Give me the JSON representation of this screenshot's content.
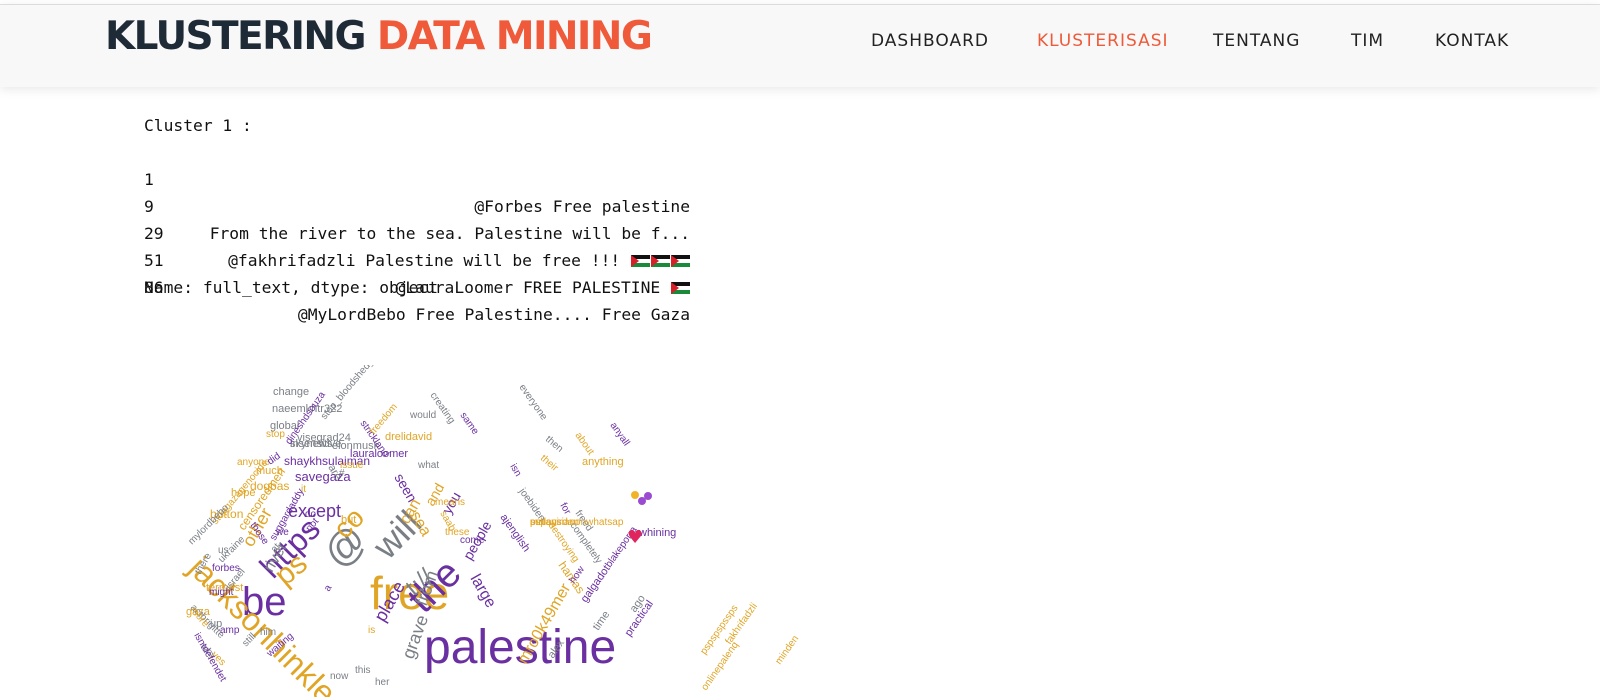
{
  "header": {
    "brand_part1": "KLUSTERING",
    "brand_part2": "DATA MINING",
    "nav": [
      {
        "label": "DASHBOARD",
        "active": false
      },
      {
        "label": "KLUSTERISASI",
        "active": true
      },
      {
        "label": "TENTANG",
        "active": false
      },
      {
        "label": "TIM",
        "active": false
      },
      {
        "label": "KONTAK",
        "active": false
      }
    ]
  },
  "output": {
    "heading": "Cluster 1 :",
    "rows": [
      {
        "index": "1",
        "text": "@Forbes Free palestine",
        "flags": 0
      },
      {
        "index": "9",
        "text": "From the river to the sea. Palestine will be f...",
        "flags": 0
      },
      {
        "index": "29",
        "text": "@fakhrifadzli Palestine will be free !!! ",
        "flags": 3
      },
      {
        "index": "51",
        "text": "@LauraLoomer FREE PALESTINE ",
        "flags": 1
      },
      {
        "index": "86",
        "text": "@MyLordBebo Free Palestine.... Free Gaza",
        "flags": 0
      }
    ],
    "footer": "Name: full_text, dtype: object"
  },
  "colors": {
    "brand_dark": "#1f2a37",
    "accent": "#ee5a3a",
    "wordcloud_purple": "#6a2fa0",
    "wordcloud_gold": "#e0a526",
    "wordcloud_gray": "#7a7f86"
  },
  "wordcloud": {
    "words": [
      {
        "text": "palestine",
        "color": "#6a2fa0"
      },
      {
        "text": "free",
        "color": "#e0a526"
      },
      {
        "text": "be",
        "color": "#6a2fa0"
      },
      {
        "text": "the",
        "color": "#6a2fa0"
      },
      {
        "text": "@",
        "color": "#7a7f86"
      },
      {
        "text": "will",
        "color": "#7a7f86"
      },
      {
        "text": "jacksonhinkle",
        "color": "#e0a526"
      },
      {
        "text": "https",
        "color": "#6a2fa0"
      },
      {
        "text": "co",
        "color": "#e0a526"
      },
      {
        "text": "ps",
        "color": "#e0a526"
      },
      {
        "text": "t://",
        "color": "#7a7f86"
      },
      {
        "text": "except",
        "color": "#6a2fa0"
      },
      {
        "text": "from",
        "color": "#7a7f86"
      },
      {
        "text": "place",
        "color": "#6a2fa0"
      },
      {
        "text": "grave",
        "color": "#7a7f86"
      },
      {
        "text": "large",
        "color": "#6a2fa0"
      },
      {
        "text": "people",
        "color": "#6a2fa0"
      },
      {
        "text": "mro0k49mer",
        "color": "#e0a526"
      },
      {
        "text": "other",
        "color": "#e0a526"
      },
      {
        "text": "river",
        "color": "#7a7f86"
      },
      {
        "text": "sea",
        "color": "#e0a526"
      },
      {
        "text": "you",
        "color": "#6a2fa0"
      },
      {
        "text": "can",
        "color": "#e0a526"
      },
      {
        "text": "and",
        "color": "#e0a526"
      },
      {
        "text": "seen",
        "color": "#6a2fa0"
      },
      {
        "text": "savegaza",
        "color": "#6a2fa0"
      },
      {
        "text": "shaykhsulaiman",
        "color": "#6a2fa0"
      },
      {
        "text": "censoredmen",
        "color": "#e0a526"
      },
      {
        "text": "dogbas",
        "color": "#e0a526"
      },
      {
        "text": "button",
        "color": "#e0a526"
      },
      {
        "text": "hope",
        "color": "#e0a526"
      },
      {
        "text": "much",
        "color": "#e0a526"
      },
      {
        "text": "anything",
        "color": "#e0a526"
      },
      {
        "text": "anyone",
        "color": "#e0a526"
      },
      {
        "text": "whining",
        "color": "#6a2fa0"
      },
      {
        "text": "change",
        "color": "#7a7f86"
      },
      {
        "text": "naeemkhtr322",
        "color": "#7a7f86"
      },
      {
        "text": "visegrad24",
        "color": "#7a7f86"
      },
      {
        "text": "elonmusk",
        "color": "#7a7f86"
      },
      {
        "text": "lauraloomer",
        "color": "#6a2fa0"
      },
      {
        "text": "skynews",
        "color": "#7a7f86"
      },
      {
        "text": "drelidavid",
        "color": "#e0a526"
      },
      {
        "text": "terrorist",
        "color": "#e0a526"
      },
      {
        "text": "gaza",
        "color": "#e0a526"
      },
      {
        "text": "hamas",
        "color": "#e0a526"
      },
      {
        "text": "alex",
        "color": "#7a7f86"
      },
      {
        "text": "time",
        "color": "#7a7f86"
      },
      {
        "text": "ago",
        "color": "#7a7f86"
      },
      {
        "text": "practical",
        "color": "#6a2fa0"
      },
      {
        "text": "blakeporra",
        "color": "#6a2fa0"
      },
      {
        "text": "galgadot",
        "color": "#6a2fa0"
      },
      {
        "text": "how",
        "color": "#6a2fa0"
      },
      {
        "text": "ajenglish",
        "color": "#6a2fa0"
      },
      {
        "text": "joebiden",
        "color": "#7a7f86"
      },
      {
        "text": "everyone",
        "color": "#7a7f86"
      },
      {
        "text": "global",
        "color": "#7a7f86"
      },
      {
        "text": "insensitive",
        "color": "#7a7f86"
      },
      {
        "text": "stop",
        "color": "#e0a526"
      },
      {
        "text": "us",
        "color": "#7a7f86"
      },
      {
        "text": "there",
        "color": "#7a7f86"
      },
      {
        "text": "actbrigitte",
        "color": "#7a7f86"
      },
      {
        "text": "ukraine",
        "color": "#7a7f86"
      },
      {
        "text": "israel",
        "color": "#7a7f86"
      },
      {
        "text": "forbes",
        "color": "#6a2fa0"
      },
      {
        "text": "might",
        "color": "#6a2fa0"
      },
      {
        "text": "up",
        "color": "#7a7f86"
      },
      {
        "text": "why",
        "color": "#7a7f86"
      },
      {
        "text": "yes",
        "color": "#e0a526"
      },
      {
        "text": "still",
        "color": "#7a7f86"
      },
      {
        "text": "amp",
        "color": "#6a2fa0"
      },
      {
        "text": "waiting",
        "color": "#6a2fa0"
      },
      {
        "text": "him",
        "color": "#7a7f86"
      },
      {
        "text": "now",
        "color": "#7a7f86"
      },
      {
        "text": "this",
        "color": "#7a7f86"
      },
      {
        "text": "her",
        "color": "#7a7f86"
      },
      {
        "text": "is",
        "color": "#e0a526"
      },
      {
        "text": "a",
        "color": "#6a2fa0"
      },
      {
        "text": "at",
        "color": "#7a7f86"
      },
      {
        "text": "not",
        "color": "#6a2fa0"
      },
      {
        "text": "do",
        "color": "#6a2fa0"
      },
      {
        "text": "we",
        "color": "#6a2fa0"
      },
      {
        "text": "but",
        "color": "#e0a526"
      },
      {
        "text": "are",
        "color": "#7a7f86"
      },
      {
        "text": "it",
        "color": "#e0a526"
      },
      {
        "text": "#",
        "color": "#7a7f86"
      },
      {
        "text": "what",
        "color": "#7a7f86"
      },
      {
        "text": "means",
        "color": "#e0a526"
      },
      {
        "text": "saab",
        "color": "#e0a526"
      },
      {
        "text": "these",
        "color": "#e0a526"
      },
      {
        "text": "come",
        "color": "#6a2fa0"
      },
      {
        "text": "isn",
        "color": "#6a2fa0"
      },
      {
        "text": "for",
        "color": "#6a2fa0"
      },
      {
        "text": "their",
        "color": "#e0a526"
      },
      {
        "text": "then",
        "color": "#7a7f86"
      },
      {
        "text": "freed",
        "color": "#7a7f86"
      },
      {
        "text": "completely",
        "color": "#7a7f86"
      },
      {
        "text": "destroying",
        "color": "#e0a526"
      },
      {
        "text": "issue",
        "color": "#e0a526"
      },
      {
        "text": "fakhrifadzli",
        "color": "#e0a526"
      },
      {
        "text": "pspspspssps",
        "color": "#e0a526"
      },
      {
        "text": "minden",
        "color": "#e0a526"
      },
      {
        "text": "onlinepalenq",
        "color": "#e0a526"
      },
      {
        "text": "stopgazagenocide",
        "color": "#e0a526"
      },
      {
        "text": "did",
        "color": "#6a2fa0"
      },
      {
        "text": "mylordbebo",
        "color": "#7a7f86"
      },
      {
        "text": "stop_bloodshed_in_gaza",
        "color": "#7a7f86"
      },
      {
        "text": "strickland",
        "color": "#6a2fa0"
      },
      {
        "text": "freedom",
        "color": "#e0a526"
      },
      {
        "text": "creating",
        "color": "#7a7f86"
      },
      {
        "text": "same",
        "color": "#6a2fa0"
      },
      {
        "text": "anyall",
        "color": "#6a2fa0"
      },
      {
        "text": "about",
        "color": "#e0a526"
      },
      {
        "text": "those",
        "color": "#6a2fa0"
      },
      {
        "text": "suggardaddy",
        "color": "#6a2fa0"
      },
      {
        "text": "dineshdsouza",
        "color": "#6a2fa0"
      },
      {
        "text": "would",
        "color": "#7a7f86"
      },
      {
        "text": "more",
        "color": "#e0a526"
      },
      {
        "text": "isntdefendet",
        "color": "#6a2fa0"
      },
      {
        "text": "pspsps",
        "color": "#e0a526"
      },
      {
        "text": "malaysianonwhatsap",
        "color": "#e0a526"
      },
      {
        "text": "sultanirdan",
        "color": "#e0a526"
      }
    ]
  }
}
